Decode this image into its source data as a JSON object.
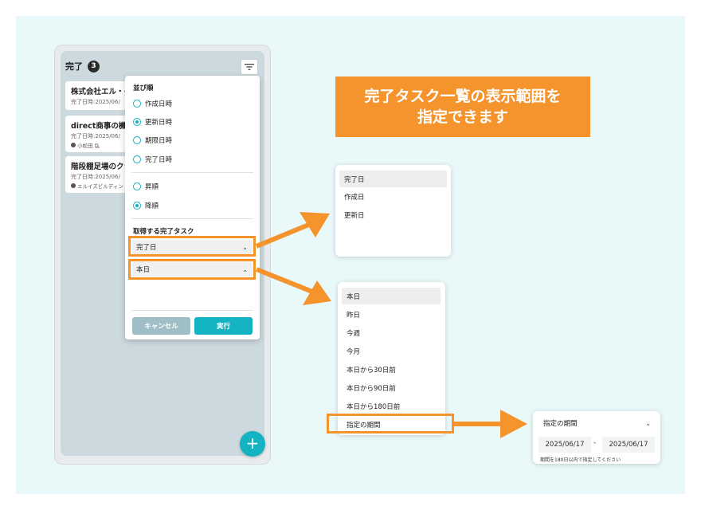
{
  "column": {
    "title": "完了",
    "count": "3",
    "cards": [
      {
        "title": "株式会社エル・イ",
        "date": "完了日時:2025/06/",
        "user": ""
      },
      {
        "title": "direct商事の機",
        "date": "完了日時:2025/06/",
        "user": "小松田 弘"
      },
      {
        "title": "階段棚足場のクラ",
        "date": "完了日時:2025/06/",
        "user": "エルイズビルディン"
      }
    ],
    "fab_label": "+"
  },
  "popup": {
    "sort_heading": "並び順",
    "sort_fields": [
      "作成日時",
      "更新日時",
      "期限日時",
      "完了日時"
    ],
    "sort_selected": "更新日時",
    "order": [
      "昇順",
      "降順"
    ],
    "order_selected": "降順",
    "fetch_heading": "取得する完了タスク",
    "select_basis": "完了日",
    "select_range": "本日",
    "cancel_label": "キャンセル",
    "exec_label": "実行"
  },
  "callout": {
    "line1": "完了タスク一覧の表示範囲を",
    "line2": "指定できます"
  },
  "basis_options": [
    "完了日",
    "作成日",
    "更新日"
  ],
  "range_options": [
    "本日",
    "昨日",
    "今週",
    "今月",
    "本日から30日前",
    "本日から90日前",
    "本日から180日前",
    "指定の期間"
  ],
  "custom_range": {
    "label": "指定の期間",
    "from": "2025/06/17",
    "separator": "-",
    "to": "2025/06/17",
    "note": "期間を180日以内で指定してください"
  },
  "colors": {
    "accent": "#14b3c2",
    "highlight": "#f5932c"
  }
}
